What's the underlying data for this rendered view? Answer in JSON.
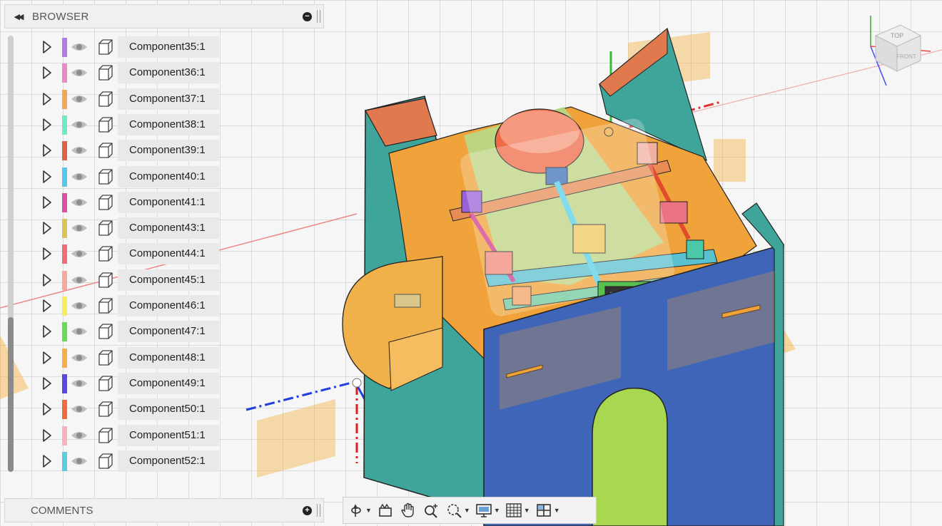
{
  "browser": {
    "title": "BROWSER",
    "items": [
      {
        "label": "Component35:1",
        "color": "#b07be8"
      },
      {
        "label": "Component36:1",
        "color": "#e88bc3"
      },
      {
        "label": "Component37:1",
        "color": "#f5a556"
      },
      {
        "label": "Component38:1",
        "color": "#6ee8c6"
      },
      {
        "label": "Component39:1",
        "color": "#d9644a"
      },
      {
        "label": "Component40:1",
        "color": "#58c8ea"
      },
      {
        "label": "Component41:1",
        "color": "#dd4fa0"
      },
      {
        "label": "Component43:1",
        "color": "#dcc25a"
      },
      {
        "label": "Component44:1",
        "color": "#ea6f7a"
      },
      {
        "label": "Component45:1",
        "color": "#f7a99c"
      },
      {
        "label": "Component46:1",
        "color": "#f4ee5e"
      },
      {
        "label": "Component47:1",
        "color": "#66dc53"
      },
      {
        "label": "Component48:1",
        "color": "#f7ad4a"
      },
      {
        "label": "Component49:1",
        "color": "#5a49e0"
      },
      {
        "label": "Component50:1",
        "color": "#ee6b3e"
      },
      {
        "label": "Component51:1",
        "color": "#f6b2bf"
      },
      {
        "label": "Component52:1",
        "color": "#5ecce0"
      }
    ]
  },
  "comments": {
    "title": "COMMENTS"
  },
  "viewcube": {
    "top_label": "TOP",
    "front_label": "FRONT"
  },
  "toolbar": {
    "items": [
      "orbit-icon",
      "look-at-icon",
      "pan-icon",
      "zoom-icon",
      "fit-icon",
      "display-settings-icon",
      "grid-settings-icon",
      "viewports-icon"
    ]
  }
}
